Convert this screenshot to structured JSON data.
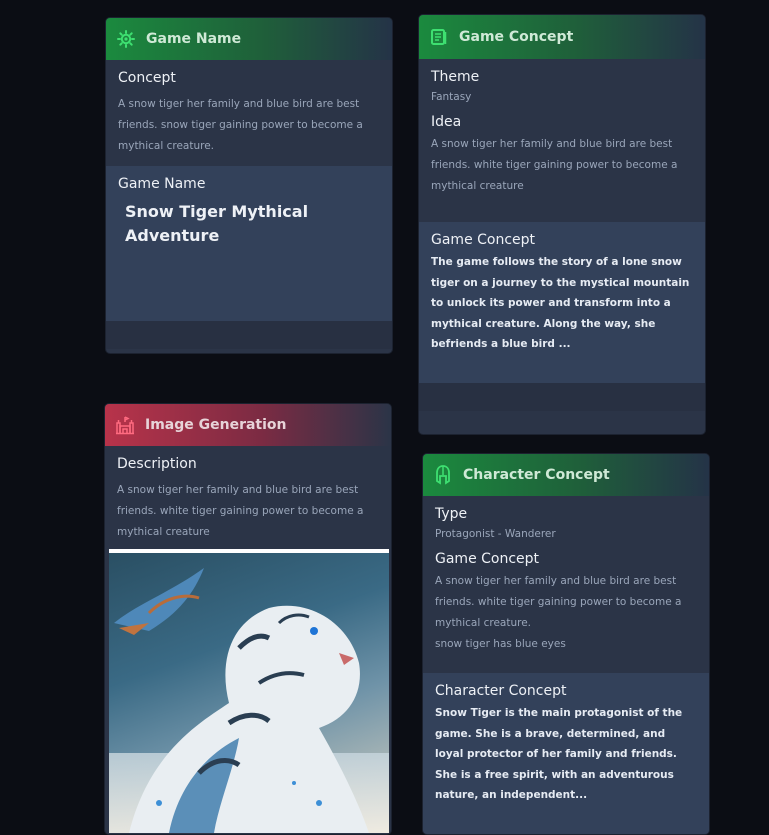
{
  "cards": {
    "game_name": {
      "title": "Game Name",
      "concept_label": "Concept",
      "concept_text": "A snow tiger her family and blue bird are best friends. snow tiger gaining power to become a mythical creature.",
      "name_label": "Game Name",
      "name_value": "Snow Tiger Mythical Adventure"
    },
    "game_concept": {
      "title": "Game Concept",
      "theme_label": "Theme",
      "theme_value": "Fantasy",
      "idea_label": "Idea",
      "idea_text": "A snow tiger her family and blue bird are best friends. white tiger gaining power to become a mythical creature",
      "concept_label": "Game Concept",
      "concept_text": "The game follows the story of a lone snow tiger on a journey to the mystical mountain to unlock its power and transform into a mythical creature. Along the way, she befriends a blue bird ..."
    },
    "image_generation": {
      "title": "Image Generation",
      "description_label": "Description",
      "description_text": "A snow tiger her family and blue bird are best friends. white tiger gaining power to become a mythical creature"
    },
    "character_concept": {
      "title": "Character Concept",
      "type_label": "Type",
      "type_value": "Protagonist - Wanderer",
      "concept_label": "Game Concept",
      "concept_text": "A snow tiger her family and blue bird are best friends. white tiger gaining power to become a mythical creature.",
      "concept_note": "snow tiger has blue eyes",
      "char_label": "Character Concept",
      "char_text": "Snow Tiger is the main protagonist of the game. She is a brave, determined, and loyal protector of her family and friends. She is a free spirit, with an adventurous nature, an independent..."
    }
  },
  "colors": {
    "green_header": "#1b8a3e",
    "red_header": "#b8334a",
    "card_bg": "#2b3447",
    "output_bg": "#33415a",
    "page_bg": "#0b0d14"
  },
  "icons": {
    "game_name": "gear-sun-icon",
    "game_concept": "book-icon",
    "image_generation": "castle-icon",
    "character_concept": "spartan-helmet-icon"
  }
}
